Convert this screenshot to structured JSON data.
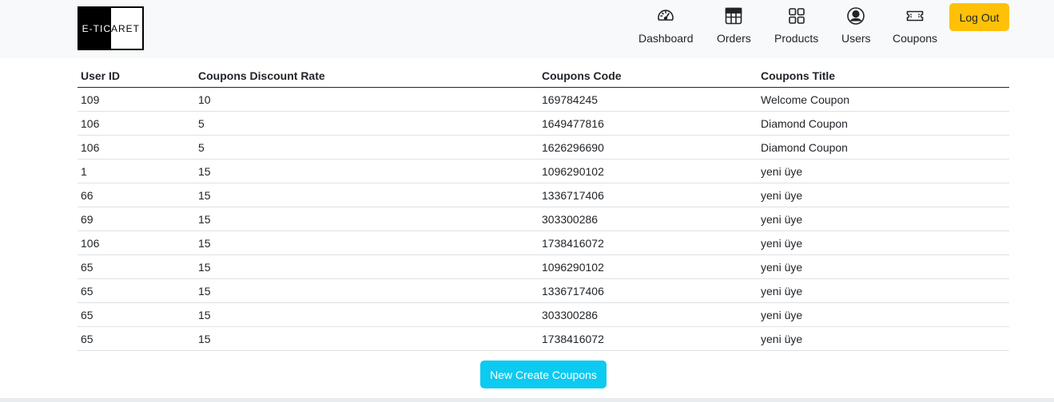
{
  "brand": {
    "logo_left": "E-TIC",
    "logo_right": "ARET"
  },
  "nav": {
    "dashboard": "Dashboard",
    "orders": "Orders",
    "products": "Products",
    "users": "Users",
    "coupons": "Coupons",
    "logout": "Log Out"
  },
  "table": {
    "headers": [
      "User ID",
      "Coupons Discount Rate",
      "Coupons Code",
      "Coupons Title"
    ],
    "rows": [
      [
        "109",
        "10",
        "169784245",
        "Welcome Coupon"
      ],
      [
        "106",
        "5",
        "1649477816",
        "Diamond Coupon"
      ],
      [
        "106",
        "5",
        "1626296690",
        "Diamond Coupon"
      ],
      [
        "1",
        "15",
        "1096290102",
        "yeni üye"
      ],
      [
        "66",
        "15",
        "1336717406",
        "yeni üye"
      ],
      [
        "69",
        "15",
        "303300286",
        "yeni üye"
      ],
      [
        "106",
        "15",
        "1738416072",
        "yeni üye"
      ],
      [
        "65",
        "15",
        "1096290102",
        "yeni üye"
      ],
      [
        "65",
        "15",
        "1336717406",
        "yeni üye"
      ],
      [
        "65",
        "15",
        "303300286",
        "yeni üye"
      ],
      [
        "65",
        "15",
        "1738416072",
        "yeni üye"
      ]
    ]
  },
  "actions": {
    "create_label": "New Create Coupons"
  },
  "colors": {
    "logout_bg": "#ffc107",
    "create_bg": "#0dcaf0",
    "navbar_bg": "#f8f9fa"
  },
  "icons": [
    "speedometer-icon",
    "table-icon",
    "grid-icon",
    "person-circle-icon",
    "ticket-icon"
  ]
}
